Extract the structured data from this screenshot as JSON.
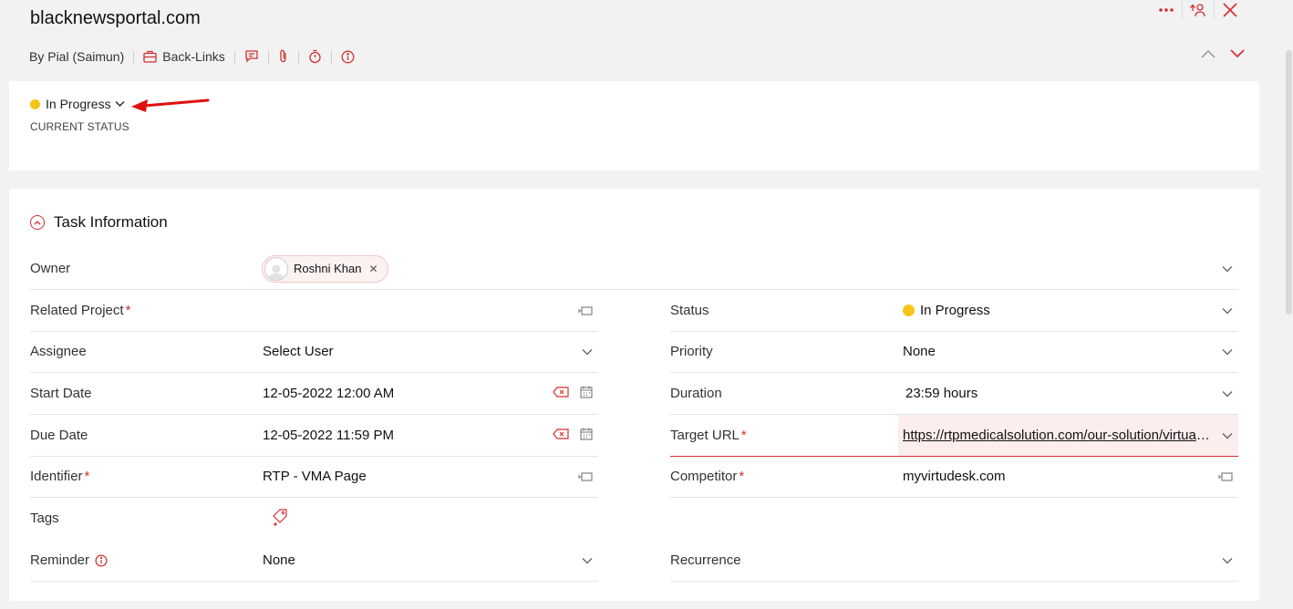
{
  "header": {
    "title": "blacknewsportal.com",
    "author": "By Pial (Saimun)",
    "backlinks_label": "Back-Links"
  },
  "status_card": {
    "status": "In Progress",
    "label": "CURRENT STATUS",
    "status_color": "#f5c518"
  },
  "section": {
    "title": "Task Information"
  },
  "fields": {
    "owner": {
      "label": "Owner",
      "value": "Roshni Khan"
    },
    "related_project": {
      "label": "Related Project",
      "required": "*",
      "value": ""
    },
    "status": {
      "label": "Status",
      "value": "In Progress"
    },
    "assignee": {
      "label": "Assignee",
      "value": "Select User"
    },
    "priority": {
      "label": "Priority",
      "value": "None"
    },
    "start_date": {
      "label": "Start Date",
      "value": "12-05-2022 12:00 AM"
    },
    "duration": {
      "label": "Duration",
      "value": "23:59 hours"
    },
    "due_date": {
      "label": "Due Date",
      "value": "12-05-2022 11:59 PM"
    },
    "target_url": {
      "label": "Target URL",
      "required": "*",
      "value": "https://rtpmedicalsolution.com/our-solution/virtual-medical-assistant/"
    },
    "identifier": {
      "label": "Identifier",
      "required": "*",
      "value": "RTP - VMA Page"
    },
    "competitor": {
      "label": "Competitor",
      "required": "*",
      "value": "myvirtudesk.com"
    },
    "tags": {
      "label": "Tags"
    },
    "reminder": {
      "label": "Reminder",
      "value": "None"
    },
    "recurrence": {
      "label": "Recurrence",
      "value": ""
    }
  },
  "colors": {
    "accent": "#d32f2f",
    "status_yellow": "#f5c518"
  }
}
